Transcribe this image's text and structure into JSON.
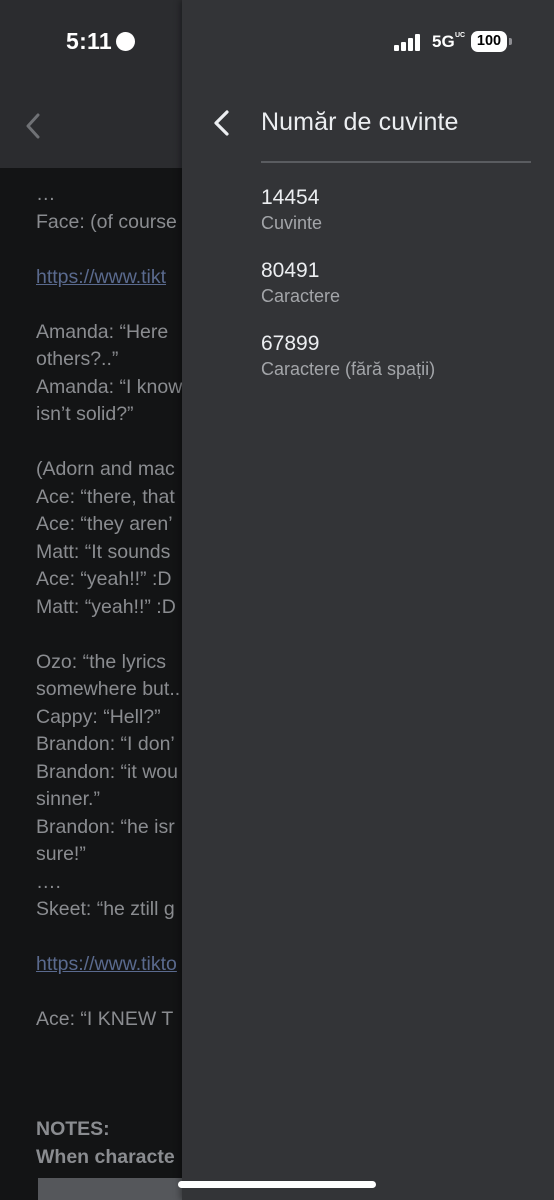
{
  "status_bar": {
    "time": "5:11",
    "network": "5G",
    "network_sub": "UC",
    "battery": "100"
  },
  "document": {
    "lines": [
      {
        "text": "…",
        "style": "text"
      },
      {
        "text": "Face: (of course",
        "style": "text"
      },
      {
        "text": "",
        "style": "text"
      },
      {
        "text": "https://www.tikt",
        "style": "link"
      },
      {
        "text": "",
        "style": "text"
      },
      {
        "text": "Amanda: “Here",
        "style": "text"
      },
      {
        "text": "others?..”",
        "style": "text"
      },
      {
        "text": "Amanda: “I know",
        "style": "text"
      },
      {
        "text": "isn’t solid?”",
        "style": "text"
      },
      {
        "text": "",
        "style": "text"
      },
      {
        "text": "(Adorn and mac",
        "style": "text"
      },
      {
        "text": "Ace: “there, that",
        "style": "text"
      },
      {
        "text": "Ace: “they aren’",
        "style": "text"
      },
      {
        "text": "Matt: “It sounds",
        "style": "text"
      },
      {
        "text": "Ace: “yeah!!” :D",
        "style": "text"
      },
      {
        "text": "Matt: “yeah!!” :D",
        "style": "text"
      },
      {
        "text": "",
        "style": "text"
      },
      {
        "text": "Ozo: “the lyrics",
        "style": "text"
      },
      {
        "text": "somewhere but..",
        "style": "text"
      },
      {
        "text": "Cappy: “Hell?”",
        "style": "text"
      },
      {
        "text": "Brandon: “I don’",
        "style": "text"
      },
      {
        "text": "Brandon: “it wou",
        "style": "text"
      },
      {
        "text": "sinner.”",
        "style": "text"
      },
      {
        "text": "Brandon: “he isr",
        "style": "text"
      },
      {
        "text": "sure!”",
        "style": "text"
      },
      {
        "text": "….",
        "style": "text"
      },
      {
        "text": "Skeet: “he ztill g",
        "style": "text"
      },
      {
        "text": "",
        "style": "text"
      },
      {
        "text": "https://www.tikto",
        "style": "link"
      },
      {
        "text": "",
        "style": "text"
      },
      {
        "text": "Ace: “I KNEW T",
        "style": "text"
      },
      {
        "text": "",
        "style": "text"
      },
      {
        "text": "",
        "style": "text"
      },
      {
        "text": "",
        "style": "text"
      },
      {
        "text": "NOTES:",
        "style": "bold"
      },
      {
        "text": "When characte",
        "style": "bold"
      }
    ]
  },
  "panel": {
    "title": "Număr de cuvinte",
    "stats": [
      {
        "value": "14454",
        "label": "Cuvinte"
      },
      {
        "value": "80491",
        "label": "Caractere"
      },
      {
        "value": "67899",
        "label": "Caractere (fără spații)"
      }
    ]
  }
}
